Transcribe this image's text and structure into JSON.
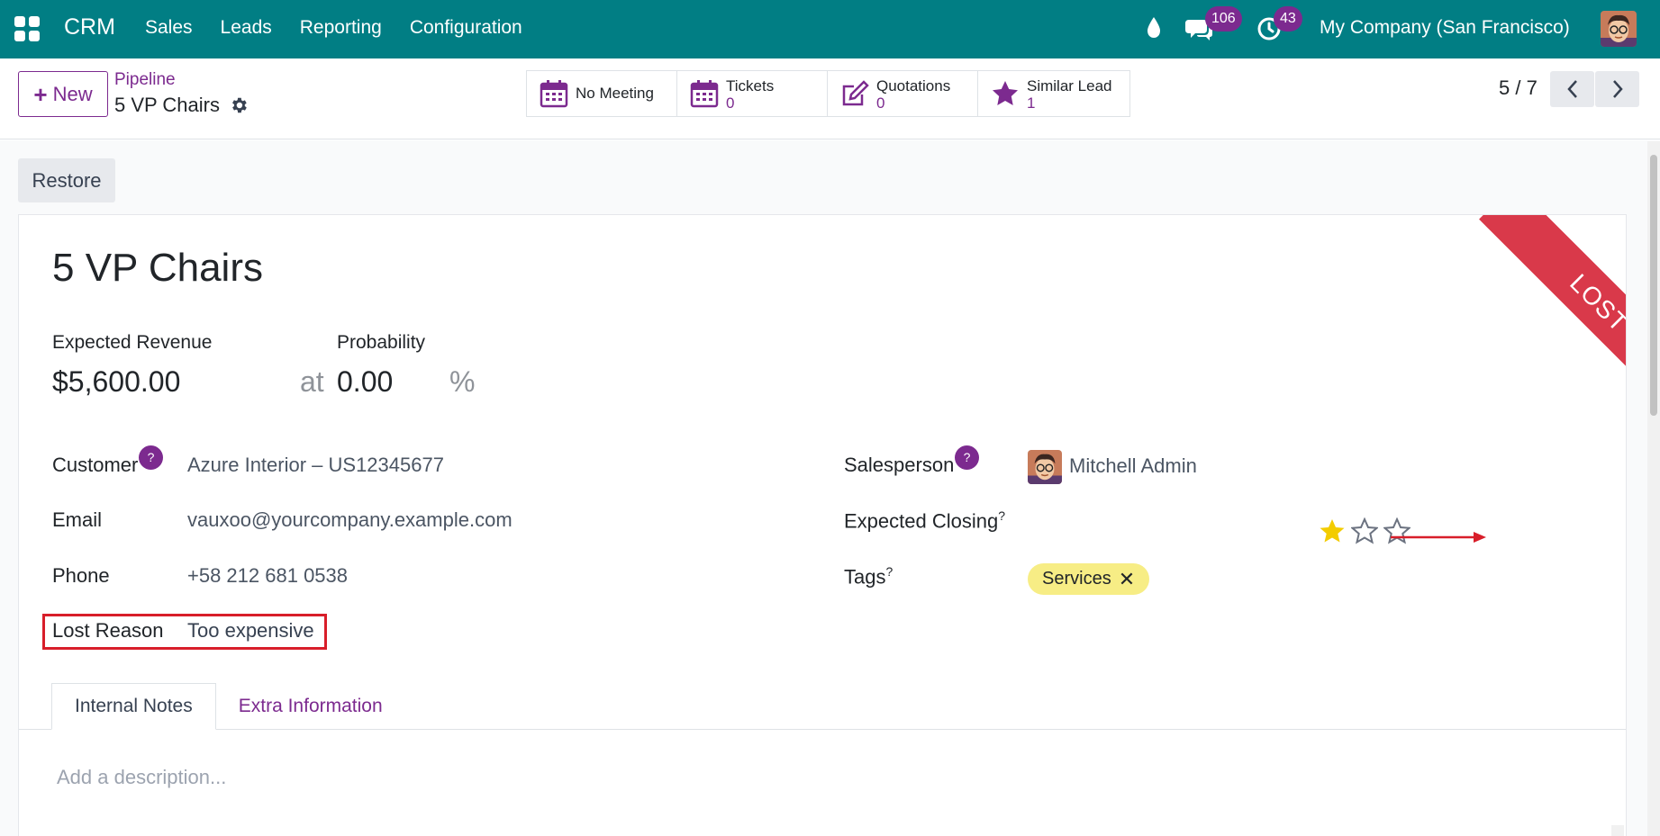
{
  "navbar": {
    "brand": "CRM",
    "menu": [
      "Sales",
      "Leads",
      "Reporting",
      "Configuration"
    ],
    "chat_badge": "106",
    "activity_badge": "43",
    "company": "My Company (San Francisco)",
    "icons": [
      "apps-grid-icon",
      "drop-icon",
      "chat-icon",
      "clock-icon",
      "user-avatar"
    ]
  },
  "control": {
    "new_label": "New",
    "breadcrumb_parent": "Pipeline",
    "breadcrumb_current": "5 VP Chairs",
    "smart_buttons": [
      {
        "label": "No Meeting",
        "value": "",
        "icon": "calendar-icon"
      },
      {
        "label": "Tickets",
        "value": "0",
        "icon": "calendar-icon"
      },
      {
        "label": "Quotations",
        "value": "0",
        "icon": "edit-icon"
      },
      {
        "label": "Similar Lead",
        "value": "1",
        "icon": "star-icon"
      }
    ],
    "pager": "5 / 7"
  },
  "form": {
    "restore_label": "Restore",
    "ribbon": "LOST",
    "title": "5 VP Chairs",
    "expected_revenue_label": "Expected Revenue",
    "expected_revenue": "$5,600.00",
    "at": "at",
    "probability_label": "Probability",
    "probability": "0.00",
    "percent": "%",
    "customer_label": "Customer",
    "customer": "Azure Interior – US12345677",
    "email_label": "Email",
    "email": "vauxoo@yourcompany.example.com",
    "phone_label": "Phone",
    "phone": "+58 212 681 0538",
    "lost_reason_label": "Lost Reason",
    "lost_reason": "Too expensive",
    "salesperson_label": "Salesperson",
    "salesperson": "Mitchell Admin",
    "expected_closing_label": "Expected Closing",
    "tags_label": "Tags",
    "tag": "Services",
    "priority_stars": 1,
    "priority_max": 3,
    "help_mark": "?",
    "tabs": [
      "Internal Notes",
      "Extra Information"
    ],
    "description_placeholder": "Add a description...",
    "colors": {
      "accent": "#7c2a8f",
      "navbar": "#017e84",
      "ribbon": "#d9394a",
      "tag": "#f7ed85",
      "star": "#f3cc00"
    }
  }
}
